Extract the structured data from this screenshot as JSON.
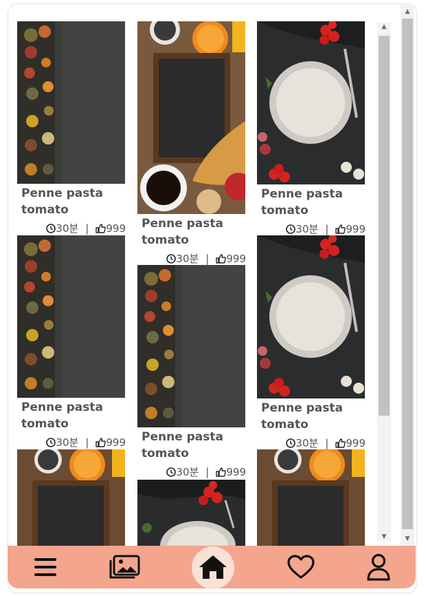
{
  "recipe_cards": [
    {
      "title": "Penne pasta tomato",
      "time": "30분",
      "likes": "999",
      "image": "spices-board"
    },
    {
      "title": "Penne pasta tomato",
      "time": "30분",
      "likes": "999",
      "image": "chalkboard-breakfast"
    },
    {
      "title": "Penne pasta tomato",
      "time": "30분",
      "likes": "999",
      "image": "plate-tomatoes"
    },
    {
      "title": "Penne pasta tomato",
      "time": "30분",
      "likes": "999",
      "image": "spices-board"
    },
    {
      "title": "Penne pasta tomato",
      "time": "30분",
      "likes": "999",
      "image": "spices-board"
    },
    {
      "title": "Penne pasta tomato",
      "time": "30분",
      "likes": "999",
      "image": "plate-tomatoes"
    },
    {
      "title": "",
      "time": "",
      "likes": "",
      "image": "chalkboard-breakfast"
    },
    {
      "title": "",
      "time": "",
      "likes": "",
      "image": "plate-tomatoes"
    },
    {
      "title": "",
      "time": "",
      "likes": "",
      "image": "chalkboard-breakfast"
    }
  ],
  "separator": "|",
  "nav": {
    "items": [
      {
        "name": "menu",
        "icon": "hamburger-icon"
      },
      {
        "name": "gallery",
        "icon": "gallery-icon"
      },
      {
        "name": "home",
        "icon": "home-icon",
        "active": true
      },
      {
        "name": "favorites",
        "icon": "heart-icon"
      },
      {
        "name": "profile",
        "icon": "user-icon"
      }
    ],
    "bar_color": "#f4a58d",
    "active_color": "#fbe0d6"
  }
}
